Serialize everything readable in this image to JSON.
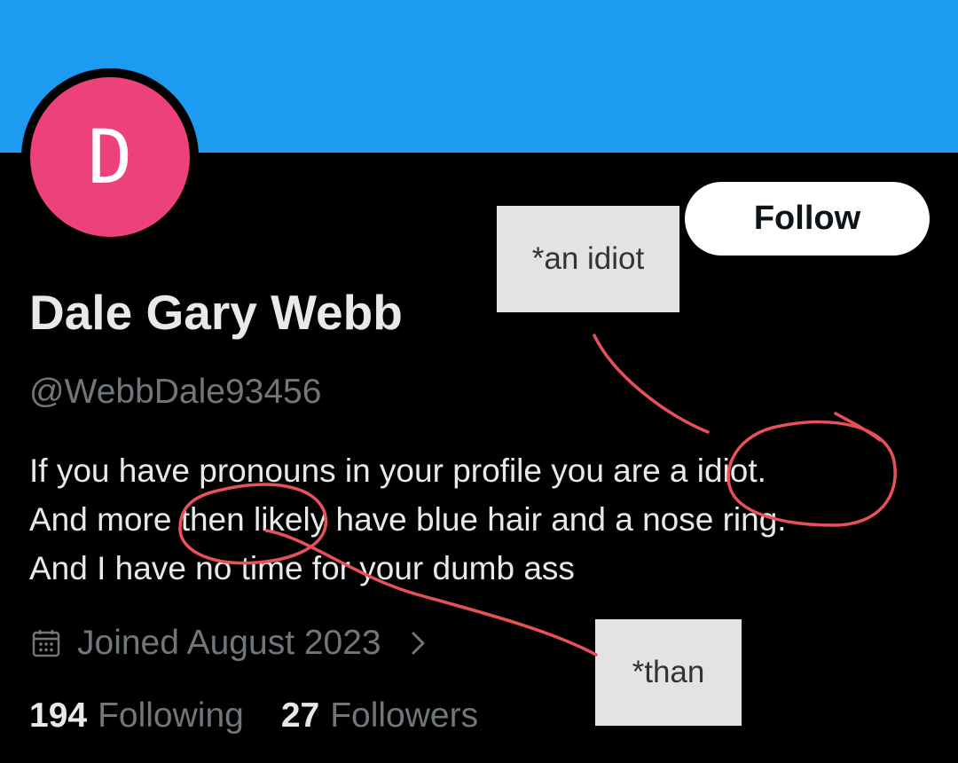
{
  "profile": {
    "avatar_letter": "D",
    "avatar_color": "#ed4179",
    "banner_color": "#1d9bf0",
    "name": "Dale Gary Webb",
    "handle": "@WebbDale93456",
    "bio_lines": [
      "If you have pronouns in your profile you are a idiot.",
      "And more then likely have blue hair and a nose ring.",
      "And I have no time for your dumb ass"
    ],
    "joined": "Joined August 2023",
    "joined_icon": "calendar-icon",
    "follow_label": "Follow",
    "following_count": "194",
    "following_label": "Following",
    "followers_count": "27",
    "followers_label": "Followers"
  },
  "annotations": {
    "note1": "*an idiot",
    "note2": "*than",
    "ink_color": "#e8515a"
  }
}
